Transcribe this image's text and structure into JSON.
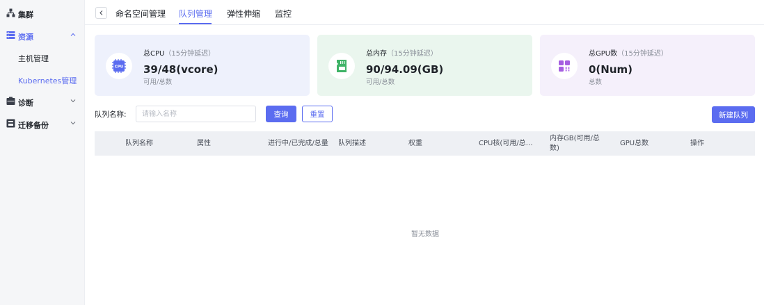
{
  "sidebar": {
    "items": [
      {
        "label": "集群",
        "icon": "cluster-icon"
      },
      {
        "label": "资源",
        "icon": "resource-icon",
        "expanded": true
      },
      {
        "label": "诊断",
        "icon": "diagnosis-icon"
      },
      {
        "label": "迁移备份",
        "icon": "migrate-icon"
      }
    ],
    "sub_items": [
      {
        "label": "主机管理"
      },
      {
        "label": "Kubernetes管理",
        "active": true
      }
    ]
  },
  "tabs": [
    {
      "label": "命名空间管理"
    },
    {
      "label": "队列管理",
      "active": true
    },
    {
      "label": "弹性伸缩"
    },
    {
      "label": "监控"
    }
  ],
  "cards": [
    {
      "title": "总CPU",
      "subtitle": "（15分钟延迟）",
      "value": "39/48(vcore)",
      "caption": "可用/总数",
      "bg": "#eef1fc",
      "icon": "cpu-icon",
      "icon_color": "#5b6cf0",
      "icon_text": "CPU"
    },
    {
      "title": "总内存",
      "subtitle": "（15分钟延迟）",
      "value": "90/94.09(GB)",
      "caption": "可用/总数",
      "bg": "#eaf6ee",
      "icon": "memory-icon",
      "icon_color": "#3fb367"
    },
    {
      "title": "总GPU数",
      "subtitle": "（15分钟延迟）",
      "value": "0(Num)",
      "caption": "总数",
      "bg": "#f5f0fb",
      "icon": "gpu-icon",
      "icon_color": "#a55fe0"
    }
  ],
  "filter": {
    "label": "队列名称:",
    "placeholder": "请输入名称",
    "value": "",
    "query_label": "查询",
    "reset_label": "重置",
    "new_label": "新建队列"
  },
  "table": {
    "columns": [
      "队列名称",
      "属性",
      "进行中/已完成/总量",
      "队列描述",
      "权重",
      "CPU核(可用/总…",
      "内存GB(可用/总数)",
      "GPU总数",
      "操作"
    ],
    "rows": [],
    "empty_text": "暂无数据"
  },
  "colors": {
    "accent": "#5b6cf0"
  }
}
